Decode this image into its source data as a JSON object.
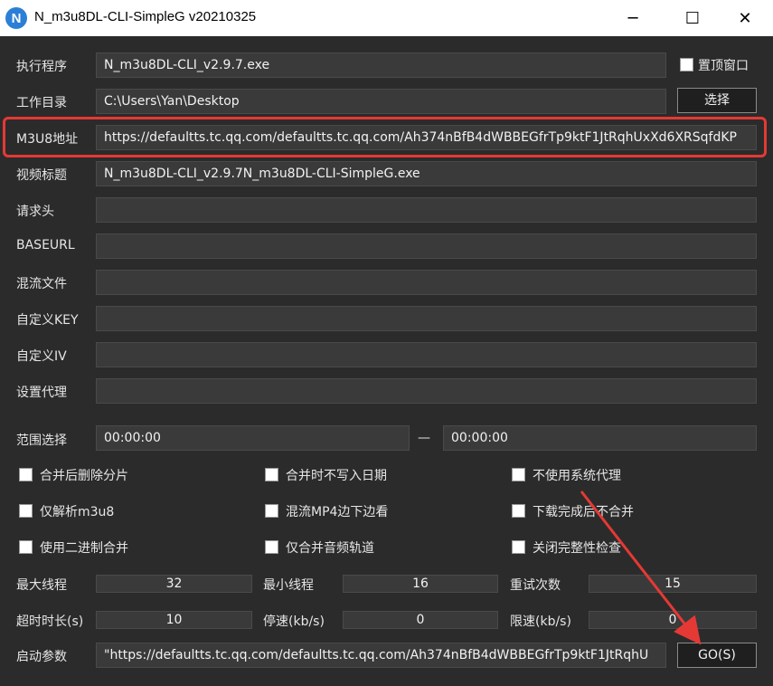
{
  "window": {
    "icon_letter": "N",
    "title": "N_m3u8DL-CLI-SimpleG v20210325",
    "minimize": "─",
    "maximize": "☐",
    "close": "✕"
  },
  "fields": {
    "exe": {
      "label": "执行程序",
      "value": "N_m3u8DL-CLI_v2.9.7.exe"
    },
    "topmost_label": "置顶窗口",
    "workdir": {
      "label": "工作目录",
      "value": "C:\\Users\\Yan\\Desktop",
      "button": "选择"
    },
    "m3u8": {
      "label": "M3U8地址",
      "value": "https://defaultts.tc.qq.com/defaultts.tc.qq.com/Ah374nBfB4dWBBEGfrTp9ktF1JtRqhUxXd6XRSqfdKP"
    },
    "title": {
      "label": "视频标题",
      "value": "N_m3u8DL-CLI_v2.9.7N_m3u8DL-CLI-SimpleG.exe"
    },
    "headers": {
      "label": "请求头",
      "value": ""
    },
    "baseurl": {
      "label": "BASEURL",
      "value": ""
    },
    "mux": {
      "label": "混流文件",
      "value": ""
    },
    "key": {
      "label": "自定义KEY",
      "value": ""
    },
    "iv": {
      "label": "自定义IV",
      "value": ""
    },
    "proxy": {
      "label": "设置代理",
      "value": ""
    },
    "range": {
      "label": "范围选择",
      "start": "00:00:00",
      "separator": "—",
      "end": "00:00:00"
    }
  },
  "checkboxes": [
    "合并后删除分片",
    "合并时不写入日期",
    "不使用系统代理",
    "仅解析m3u8",
    "混流MP4边下边看",
    "下载完成后不合并",
    "使用二进制合并",
    "仅合并音频轨道",
    "关闭完整性检查"
  ],
  "numbers": {
    "max_threads": {
      "label": "最大线程",
      "value": "32"
    },
    "min_threads": {
      "label": "最小线程",
      "value": "16"
    },
    "retry": {
      "label": "重试次数",
      "value": "15"
    },
    "timeout": {
      "label": "超时时长(s)",
      "value": "10"
    },
    "stop_speed": {
      "label": "停速(kb/s)",
      "value": "0"
    },
    "limit_speed": {
      "label": "限速(kb/s)",
      "value": "0"
    }
  },
  "launch": {
    "label": "启动参数",
    "value": "\"https://defaultts.tc.qq.com/defaultts.tc.qq.com/Ah374nBfB4dWBBEGfrTp9ktF1JtRqhU",
    "go_button": "GO(S)"
  },
  "colors": {
    "highlight": "#e53935",
    "background": "#2b2b2b",
    "field": "#3a3a3a"
  }
}
